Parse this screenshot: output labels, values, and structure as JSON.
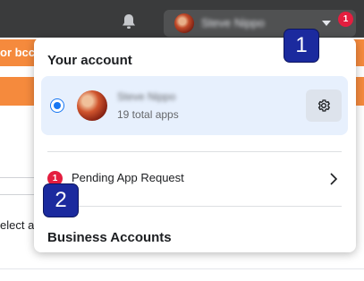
{
  "header": {
    "account_name": "Steve Nippo",
    "notification_count": "1"
  },
  "background": {
    "banner_text": "or bcc:",
    "select_text": "elect a"
  },
  "dropdown": {
    "title": "Your account",
    "account": {
      "name": "Steve Nippo",
      "subtitle": "19 total apps"
    },
    "pending": {
      "count": "1",
      "label": "Pending App Request"
    },
    "business_title": "Business Accounts"
  },
  "callouts": [
    "1",
    "2"
  ],
  "colors": {
    "topbar": "#3a3b3c",
    "banner": "#f58a3d",
    "selected_card": "#e7f0fd",
    "accent": "#1877f2",
    "badge": "#e41e3f",
    "callout": "#1b2a9e"
  }
}
